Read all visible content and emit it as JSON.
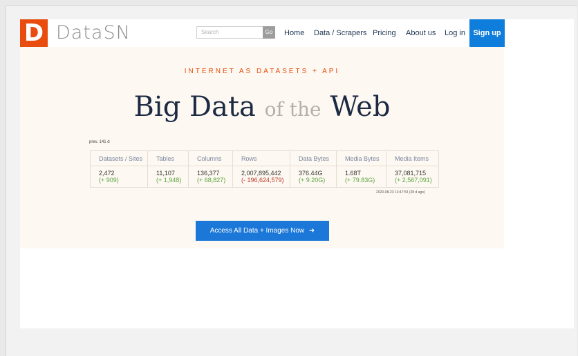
{
  "nav": {
    "logo_letter": "D",
    "logo_text": "DataSN",
    "search_placeholder": "Search",
    "go_label": "Go",
    "links": [
      "Home",
      "Data / Scrapers",
      "Pricing",
      "About us",
      "Log in"
    ],
    "signup_label": "Sign up",
    "brand_color": "#e84c0e",
    "accent_color": "#0f7ddb"
  },
  "hero": {
    "tagline": "INTERNET AS DATASETS + API",
    "headline_part1": "Big Data",
    "headline_mid": "of the",
    "headline_part2": "Web"
  },
  "stats": {
    "prev_label": "prev. 141 d",
    "headers": [
      "Datasets / Sites",
      "Tables",
      "Columns",
      "Rows",
      "Data Bytes",
      "Media Bytes",
      "Media Items"
    ],
    "values": [
      "2,472",
      "11,107",
      "136,377",
      "2,007,895,442",
      "376.44G",
      "1.68T",
      "37,081,715"
    ],
    "deltas": [
      "(+ 909)",
      "(+ 1,948)",
      "(+ 68,827)",
      "(- 196,624,579)",
      "(+ 9.20G)",
      "(+ 79.83G)",
      "(+ 2,567,091)"
    ],
    "timestamp": "2020-08-23 13:47:53 (28 d ago)"
  },
  "cta": {
    "label": "Access All Data + Images Now"
  }
}
